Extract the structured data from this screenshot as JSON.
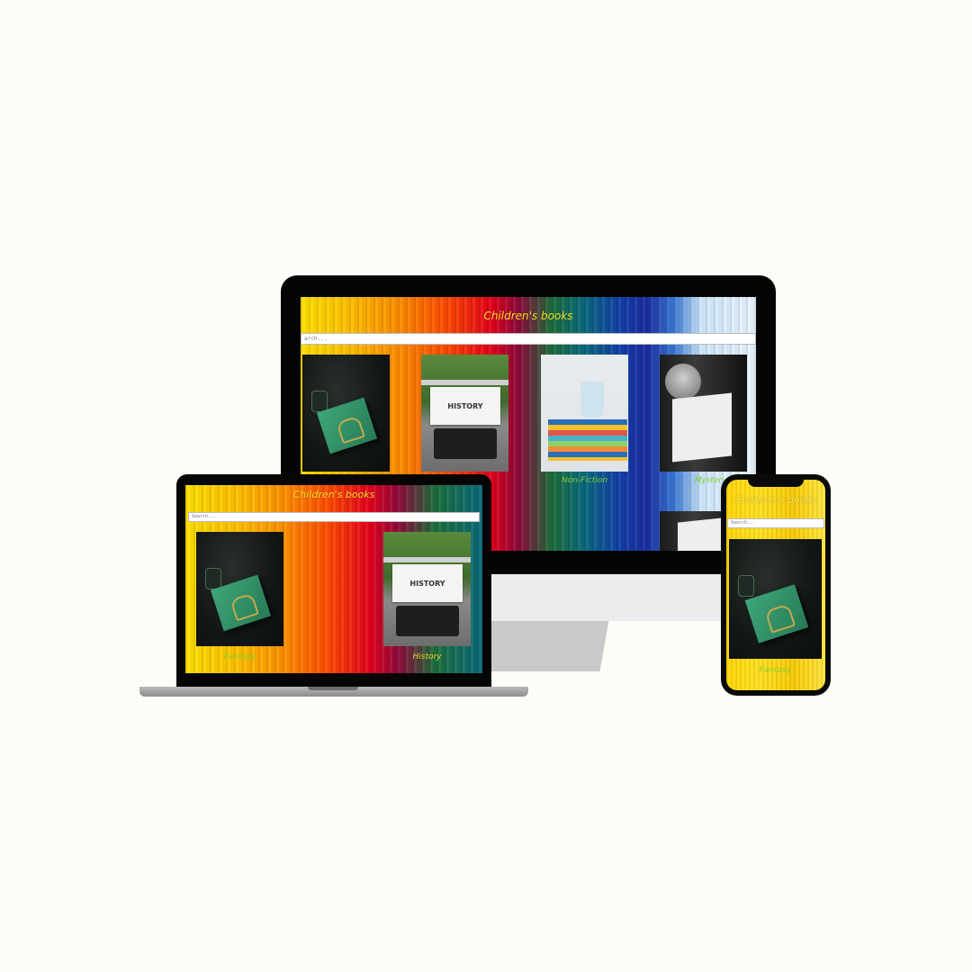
{
  "site": {
    "title": "Children's books",
    "search_placeholder": "Search...",
    "categories": [
      {
        "label": "Fantasy",
        "icon": "fantasy-book-image"
      },
      {
        "label": "History",
        "icon": "history-typewriter-image"
      },
      {
        "label": "Non-Fiction",
        "icon": "nonfiction-books-mug-image"
      },
      {
        "label": "Mystery",
        "icon": "mystery-child-reading-image"
      }
    ],
    "history_image_text": "HISTORY"
  },
  "monitor": {
    "search_visible_text": "arch..."
  },
  "colors": {
    "title": "#f2e02a",
    "category_label": "#7fd12a",
    "page_background": "#fdfdf8"
  }
}
